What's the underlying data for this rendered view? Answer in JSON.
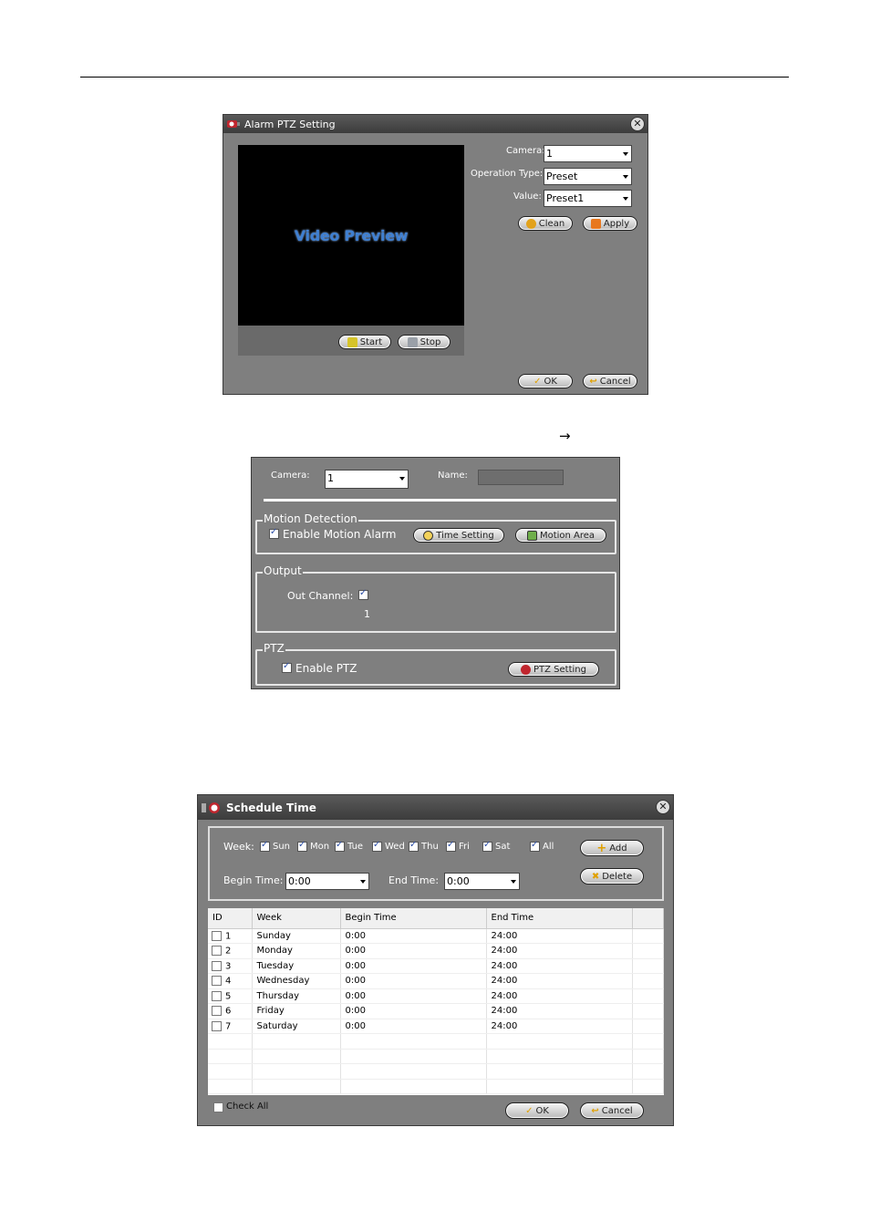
{
  "alarm_ptz": {
    "title": "Alarm PTZ Setting",
    "camera_label": "Camera:",
    "camera_value": "1",
    "operation_type_label": "Operation Type:",
    "operation_type_value": "Preset",
    "value_label": "Value:",
    "value_value": "Preset1",
    "clean_label": "Clean",
    "apply_label": "Apply",
    "video_preview_text": "Video Preview",
    "start_label": "Start",
    "stop_label": "Stop",
    "ok_label": "OK",
    "cancel_label": "Cancel"
  },
  "arrow": "→",
  "motion_panel": {
    "camera_label": "Camera:",
    "camera_value": "1",
    "name_label": "Name:",
    "name_value": "",
    "motion_group_title": "Motion Detection",
    "enable_motion_alarm": "Enable Motion Alarm",
    "time_setting_label": "Time Setting",
    "motion_area_label": "Motion Area",
    "output_group_title": "Output",
    "out_channel_label": "Out Channel:",
    "out_channel_number": "1",
    "ptz_group_title": "PTZ",
    "enable_ptz": "Enable PTZ",
    "ptz_setting_label": "PTZ Setting"
  },
  "schedule": {
    "title": "Schedule Time",
    "week_label": "Week:",
    "days": [
      "Sun",
      "Mon",
      "Tue",
      "Wed",
      "Thu",
      "Fri",
      "Sat",
      "All"
    ],
    "add_label": "Add",
    "delete_label": "Delete",
    "begin_time_label": "Begin Time:",
    "begin_time_value": "0:00",
    "end_time_label": "End Time:",
    "end_time_value": "0:00",
    "columns": [
      "ID",
      "Week",
      "Begin Time",
      "End Time"
    ],
    "rows": [
      {
        "id": "1",
        "week": "Sunday",
        "begin": "0:00",
        "end": "24:00"
      },
      {
        "id": "2",
        "week": "Monday",
        "begin": "0:00",
        "end": "24:00"
      },
      {
        "id": "3",
        "week": "Tuesday",
        "begin": "0:00",
        "end": "24:00"
      },
      {
        "id": "4",
        "week": "Wednesday",
        "begin": "0:00",
        "end": "24:00"
      },
      {
        "id": "5",
        "week": "Thursday",
        "begin": "0:00",
        "end": "24:00"
      },
      {
        "id": "6",
        "week": "Friday",
        "begin": "0:00",
        "end": "24:00"
      },
      {
        "id": "7",
        "week": "Saturday",
        "begin": "0:00",
        "end": "24:00"
      }
    ],
    "check_all_label": "Check All",
    "ok_label": "OK",
    "cancel_label": "Cancel"
  }
}
